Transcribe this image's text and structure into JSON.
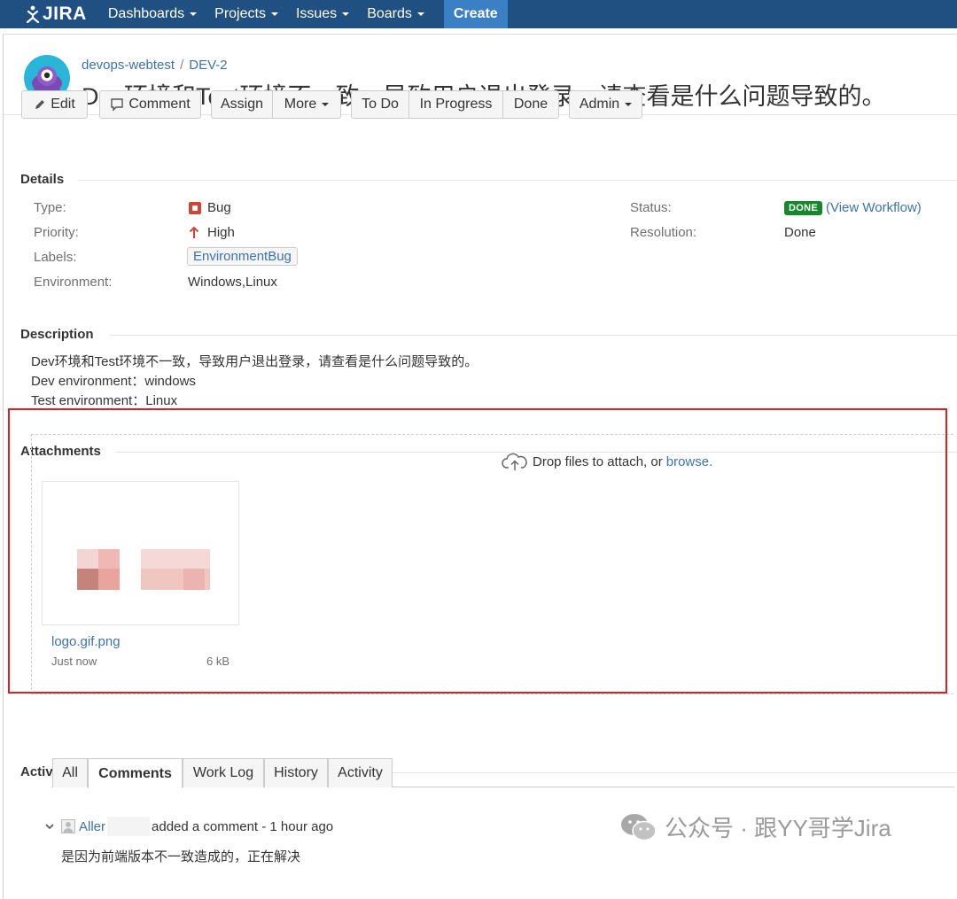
{
  "nav": {
    "logo_text": "JIRA",
    "items": [
      {
        "label": "Dashboards"
      },
      {
        "label": "Projects"
      },
      {
        "label": "Issues"
      },
      {
        "label": "Boards"
      }
    ],
    "create_label": "Create"
  },
  "issue": {
    "project": "devops-webtest",
    "key": "DEV-2",
    "title": "Dev环境和Test环境不一致，导致用户退出登录，请查看是什么问题导致的。"
  },
  "toolbar": {
    "edit": "Edit",
    "comment": "Comment",
    "assign": "Assign",
    "more": "More",
    "todo": "To Do",
    "in_progress": "In Progress",
    "done": "Done",
    "admin": "Admin"
  },
  "details": {
    "heading": "Details",
    "type_label": "Type:",
    "type_value": "Bug",
    "priority_label": "Priority:",
    "priority_value": "High",
    "labels_label": "Labels:",
    "labels_value": "EnvironmentBug",
    "environment_label": "Environment:",
    "environment_value": "Windows,Linux",
    "status_label": "Status:",
    "status_value": "DONE",
    "view_workflow_open": "(",
    "view_workflow": "View Workflow",
    "view_workflow_close": ")",
    "resolution_label": "Resolution:",
    "resolution_value": "Done"
  },
  "description": {
    "heading": "Description",
    "lines": [
      "Dev环境和Test环境不一致，导致用户退出登录，请查看是什么问题导致的。",
      "Dev environment：windows",
      "Test environment：Linux"
    ]
  },
  "attachments": {
    "heading": "Attachments",
    "drop_text": "Drop files to attach, or ",
    "browse": "browse.",
    "file_name": "logo.gif.png",
    "file_time": "Just now",
    "file_size": "6 kB"
  },
  "activity": {
    "heading": "Activity",
    "tabs": [
      "All",
      "Comments",
      "Work Log",
      "History",
      "Activity"
    ],
    "active_tab": "Comments",
    "comment_author": "Aller",
    "comment_action": "added a comment - 1 hour ago",
    "comment_body": "是因为前端版本不一致造成的，正在解决"
  },
  "watermark": "公众号 · 跟YY哥学Jira",
  "colors": {
    "nav_bg": "#205081",
    "create_bg": "#3b7fc4",
    "link": "#3b73af",
    "done_lozenge": "#14892c",
    "bug_red": "#d04437",
    "priority_red": "#d04437",
    "highlight_border": "#e02020"
  },
  "icons": {
    "logo": "jira-logo-icon",
    "edit": "pencil-icon",
    "comment": "speech-bubble-icon",
    "type": "bug-icon",
    "priority": "arrow-up-icon",
    "upload": "cloud-upload-icon",
    "collapse": "chevron-down-icon",
    "avatar": "user-avatar-icon",
    "watermark": "wechat-icon"
  }
}
